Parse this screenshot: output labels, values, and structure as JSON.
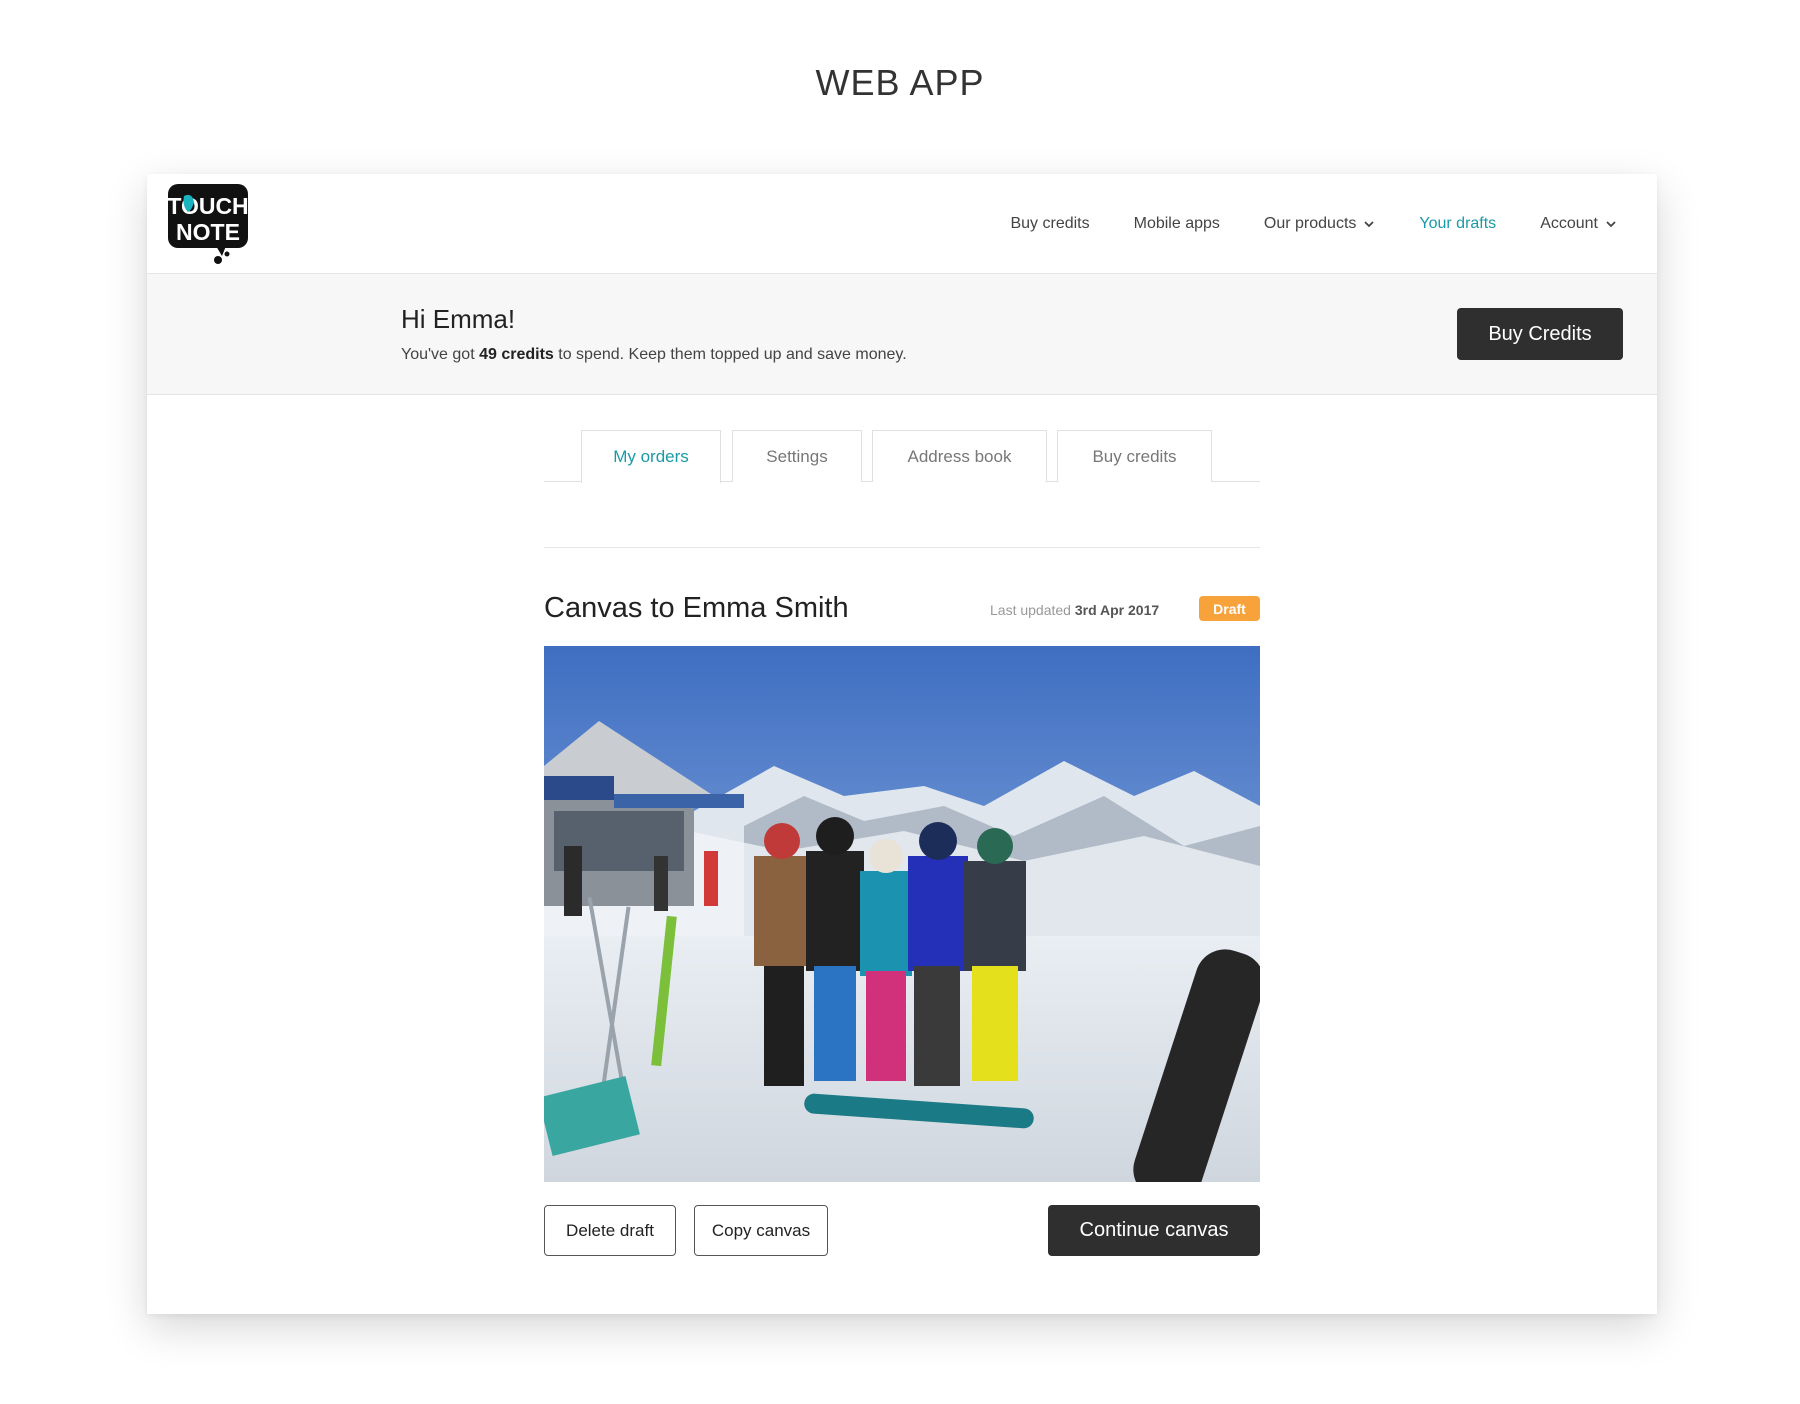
{
  "page": {
    "heading": "WEB APP"
  },
  "brand": {
    "logo_line1": "TOUCH",
    "logo_line2": "NOTE",
    "accent": "#1a9aa6"
  },
  "nav": {
    "items": [
      {
        "label": "Buy credits",
        "dropdown": false,
        "active": false
      },
      {
        "label": "Mobile apps",
        "dropdown": false,
        "active": false
      },
      {
        "label": "Our products",
        "dropdown": true,
        "active": false
      },
      {
        "label": "Your drafts",
        "dropdown": false,
        "active": true
      },
      {
        "label": "Account",
        "dropdown": true,
        "active": false
      }
    ]
  },
  "banner": {
    "greeting": "Hi Emma!",
    "credits_prefix": "You've got ",
    "credits_amount": "49 credits",
    "credits_suffix": " to spend. Keep them topped up and save money.",
    "button_label": "Buy Credits"
  },
  "tabs": [
    {
      "label": "My orders",
      "active": true
    },
    {
      "label": "Settings",
      "active": false
    },
    {
      "label": "Address book",
      "active": false
    },
    {
      "label": "Buy credits",
      "active": false
    }
  ],
  "draft": {
    "title": "Canvas to Emma Smith",
    "updated_prefix": "Last updated ",
    "updated_date": "3rd Apr 2017",
    "status": "Draft",
    "status_color": "#f7a23b",
    "image_icon": "photo-image",
    "actions": {
      "delete": "Delete draft",
      "copy": "Copy canvas",
      "continue": "Continue canvas"
    }
  }
}
